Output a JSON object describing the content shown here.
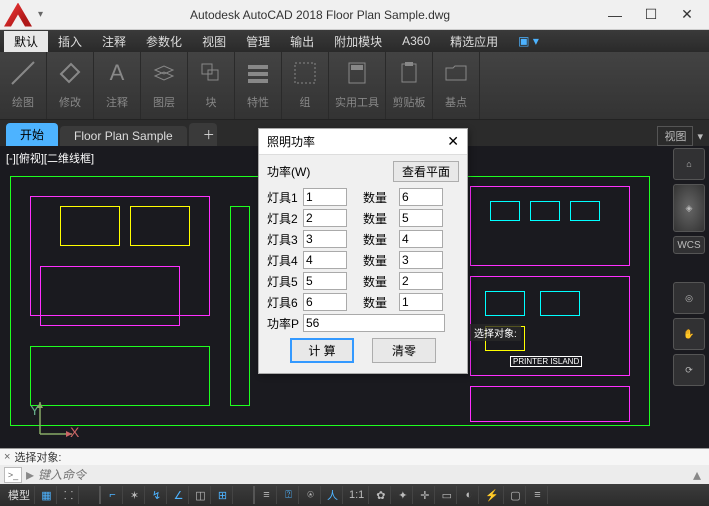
{
  "app": {
    "title": "Autodesk AutoCAD 2018    Floor Plan Sample.dwg"
  },
  "menus": {
    "default": "默认",
    "items": [
      "插入",
      "注释",
      "参数化",
      "视图",
      "管理",
      "输出",
      "附加模块",
      "A360",
      "精选应用"
    ]
  },
  "ribbon": [
    {
      "label": "绘图",
      "icon": "line"
    },
    {
      "label": "修改",
      "icon": "modify"
    },
    {
      "label": "注释",
      "icon": "text"
    },
    {
      "label": "图层",
      "icon": "layers"
    },
    {
      "label": "块",
      "icon": "block"
    },
    {
      "label": "特性",
      "icon": "props"
    },
    {
      "label": "组",
      "icon": "group"
    },
    {
      "label": "实用工具",
      "icon": "util"
    },
    {
      "label": "剪贴板",
      "icon": "clip"
    },
    {
      "label": "基点",
      "icon": "base"
    }
  ],
  "tabs": {
    "start": "开始",
    "file": "Floor Plan Sample",
    "view_label": "视图"
  },
  "viewport": {
    "label": "[-][俯视][二维线框]"
  },
  "wcs": "WCS",
  "dialog": {
    "title": "照明功率",
    "power_label": "功率(W)",
    "view_plan": "查看平面",
    "rows": [
      {
        "llabel": "灯具1",
        "lval": "1",
        "rlabel": "数量",
        "rval": "6"
      },
      {
        "llabel": "灯具2",
        "lval": "2",
        "rlabel": "数量",
        "rval": "5"
      },
      {
        "llabel": "灯具3",
        "lval": "3",
        "rlabel": "数量",
        "rval": "4"
      },
      {
        "llabel": "灯具4",
        "lval": "4",
        "rlabel": "数量",
        "rval": "3"
      },
      {
        "llabel": "灯具5",
        "lval": "5",
        "rlabel": "数量",
        "rval": "2"
      },
      {
        "llabel": "灯具6",
        "lval": "6",
        "rlabel": "数量",
        "rval": "1"
      }
    ],
    "power_p_label": "功率P",
    "power_p_value": "56",
    "calc": "计 算",
    "clear": "清零"
  },
  "cmd": {
    "history_prefix": "×",
    "history": "选择对象:",
    "placeholder": "键入命令",
    "prompt_icon": ">_"
  },
  "status": {
    "model": "模型",
    "scale": "1:1",
    "select_prompt": "选择对象:",
    "printer_label": "PRINTER ISLAND"
  }
}
